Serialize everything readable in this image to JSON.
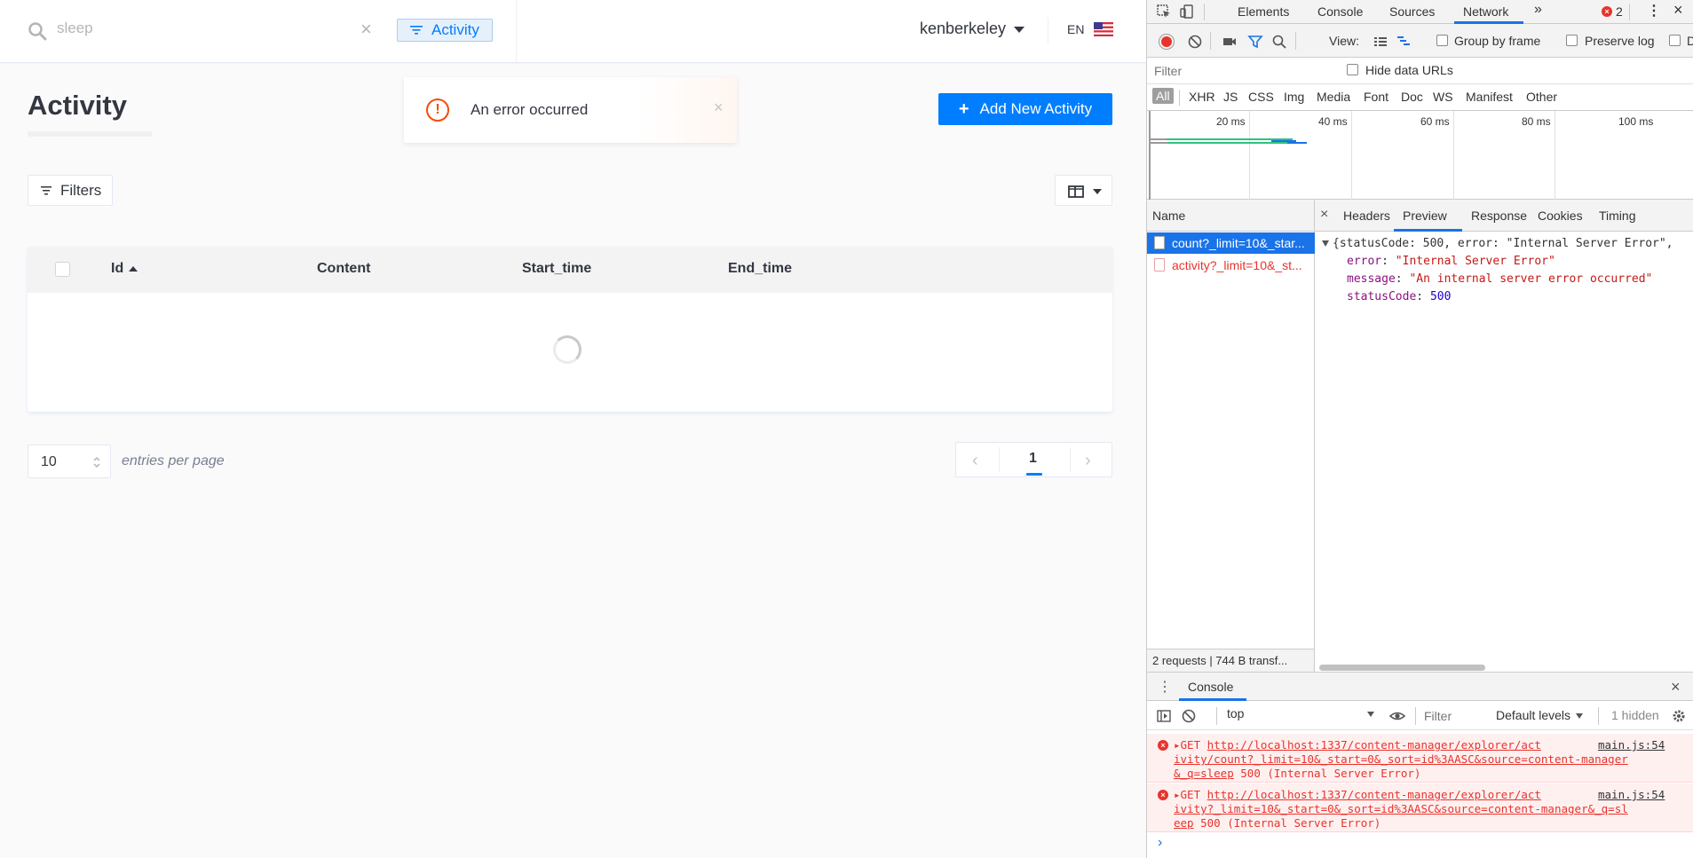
{
  "header": {
    "search_value": "sleep",
    "search_tag": "Activity",
    "user_name": "kenberkeley",
    "language": "EN"
  },
  "page": {
    "title": "Activity",
    "add_button": "Add New Activity",
    "filters_button": "Filters"
  },
  "toast": {
    "message": "An error occurred",
    "type": "error"
  },
  "table": {
    "columns": [
      "Id",
      "Content",
      "Start_time",
      "End_time"
    ],
    "sort_column": "Id",
    "sort_direction": "asc",
    "rows": [],
    "loading": true
  },
  "pagination": {
    "per_page": "10",
    "per_page_label": "entries per page",
    "current_page": "1"
  },
  "devtools": {
    "tabs": [
      "Elements",
      "Console",
      "Sources",
      "Network"
    ],
    "active_tab": "Network",
    "more_tabs": "»",
    "error_count": "2",
    "toolbar": {
      "view_label": "View:",
      "group_by_frame": "Group by frame",
      "preserve_log": "Preserve log",
      "disable_cache_cut": "D"
    },
    "filter_placeholder": "Filter",
    "hide_data_urls": "Hide data URLs",
    "types": [
      "All",
      "XHR",
      "JS",
      "CSS",
      "Img",
      "Media",
      "Font",
      "Doc",
      "WS",
      "Manifest",
      "Other"
    ],
    "timeline_labels": [
      "20 ms",
      "40 ms",
      "60 ms",
      "80 ms",
      "100 ms"
    ],
    "names_header": "Name",
    "requests": [
      {
        "name": "count?_limit=10&_star...",
        "selected": true,
        "error": false
      },
      {
        "name": "activity?_limit=10&_st...",
        "selected": false,
        "error": true
      }
    ],
    "status": "2 requests  |  744 B transf...",
    "detail_tabs": [
      "Headers",
      "Preview",
      "Response",
      "Cookies",
      "Timing"
    ],
    "active_detail_tab": "Preview",
    "preview": {
      "summary": "{statusCode: 500, error: \"Internal Server Error\",",
      "error_key": "error",
      "error_value": "\"Internal Server Error\"",
      "message_key": "message",
      "message_value": "\"An internal server error occurred\"",
      "status_key": "statusCode",
      "status_value": "500"
    },
    "console": {
      "tab": "Console",
      "context": "top",
      "filter_placeholder": "Filter",
      "levels": "Default levels",
      "hidden": "1 hidden",
      "messages": [
        {
          "method": "GET",
          "url_1": "http://localhost:1337/content-manager/explorer/act",
          "url_2": "ivity/count?_limit=10&_start=0&_sort=id%3AASC&source=content-manager",
          "url_3": "&_q=sleep",
          "status": "500 (Internal Server Error)",
          "source": "main.js:54"
        },
        {
          "method": "GET",
          "url_1": "http://localhost:1337/content-manager/explorer/act",
          "url_2": "ivity?_limit=10&_start=0&_sort=id%3AASC&source=content-manager&_q=sl",
          "url_3": "eep",
          "status": "500 (Internal Server Error)",
          "source": "main.js:54"
        }
      ]
    }
  }
}
